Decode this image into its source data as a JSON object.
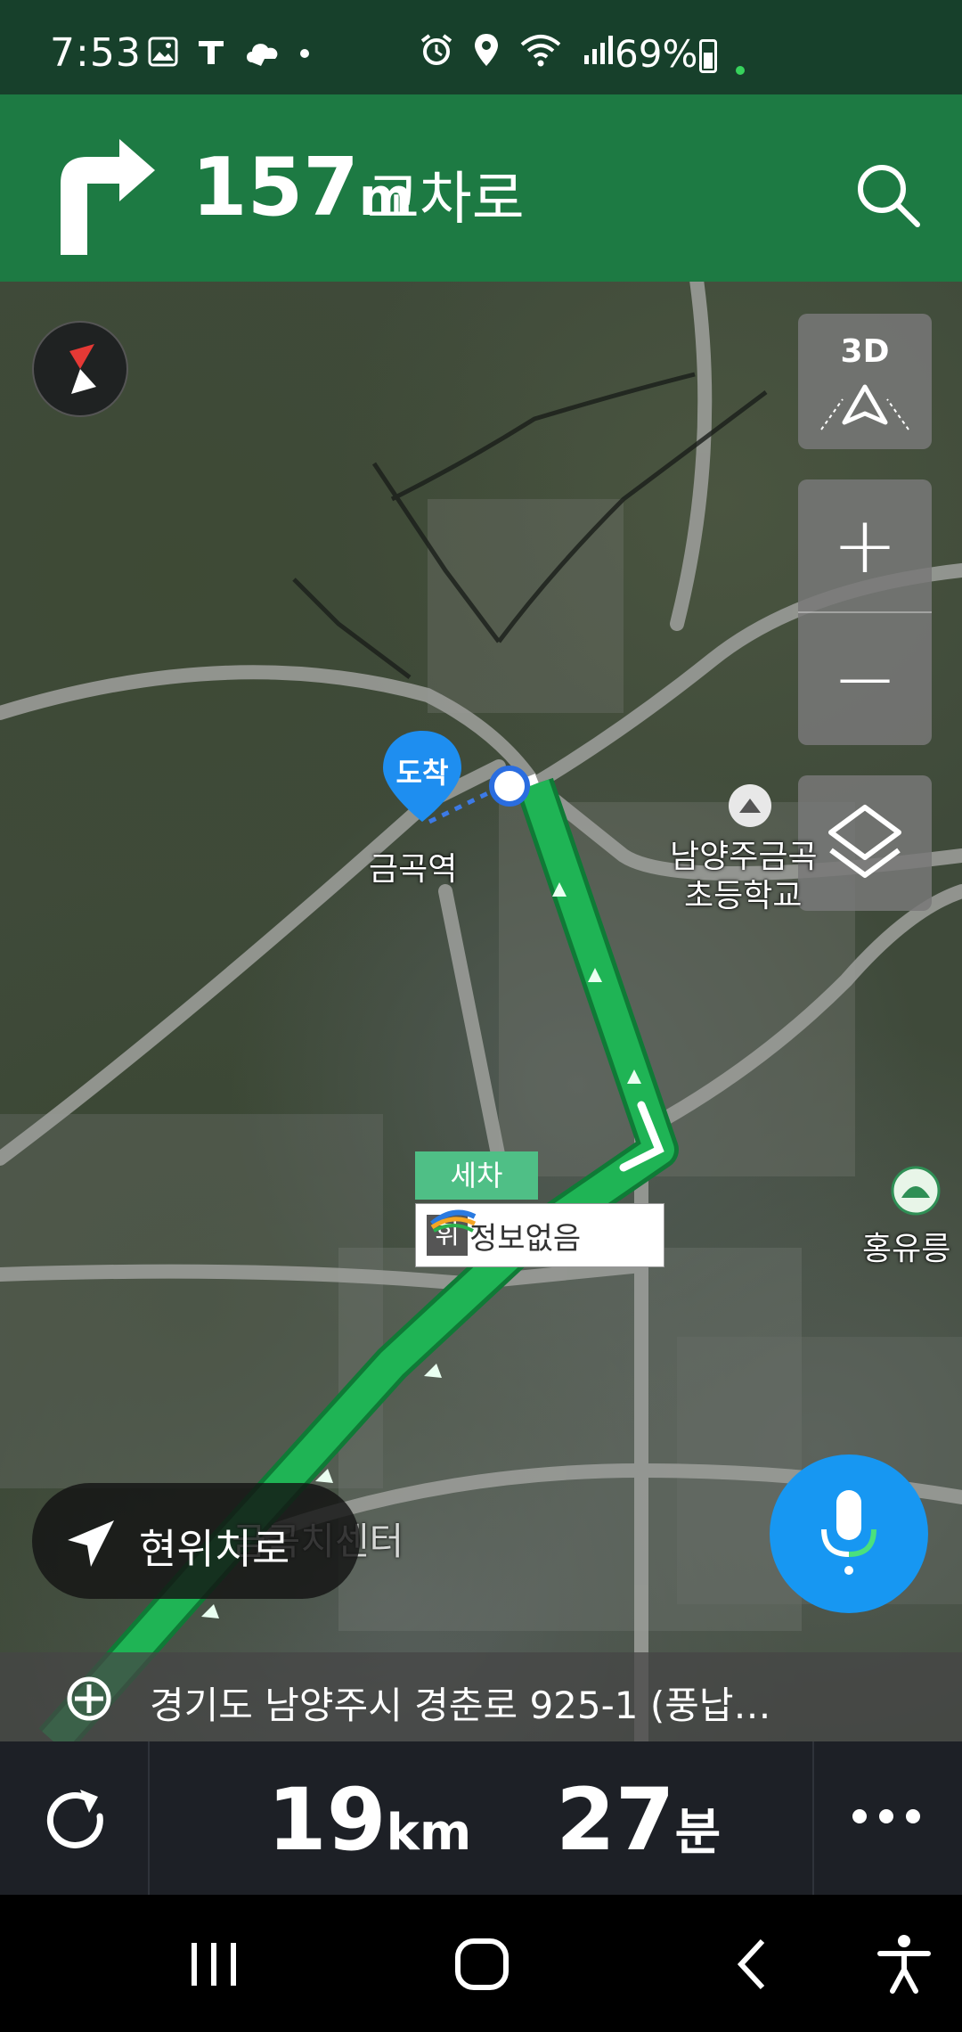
{
  "status_bar": {
    "time": "7:53",
    "battery": "69%"
  },
  "navigation": {
    "distance_value": "157",
    "distance_unit": "m",
    "road": "교차로"
  },
  "map": {
    "controls": {
      "view_3d": "3D",
      "zoom_in": "+",
      "zoom_out": "−"
    },
    "labels": {
      "destination_pin": "도착",
      "station": "금곡역",
      "school_line1": "남양주금곡",
      "school_line2": "초등학교",
      "tomb": "홍유릉",
      "car_wash": "세차",
      "rest_area_badge": "휘",
      "rest_area_info": "정보없음",
      "center_label": "금곡치센터"
    },
    "my_location_button": "현위치로"
  },
  "address_bar": {
    "text": "경기도 남양주시 경춘로 925-1 (풍납…"
  },
  "summary": {
    "distance_value": "19",
    "distance_unit": "km",
    "time_value": "27",
    "time_unit": "분"
  },
  "colors": {
    "status_bg": "#17402b",
    "nav_bg": "#1d7a43",
    "route": "#1fb455",
    "mic": "#1797f2",
    "bottom_bg": "#1d2026"
  },
  "icons": [
    "right-turn-arrow-icon",
    "search-icon",
    "compass-icon",
    "3d-view-icon",
    "layers-icon",
    "location-arrow-icon",
    "microphone-icon",
    "gps-target-icon",
    "refresh-icon",
    "more-icon"
  ]
}
